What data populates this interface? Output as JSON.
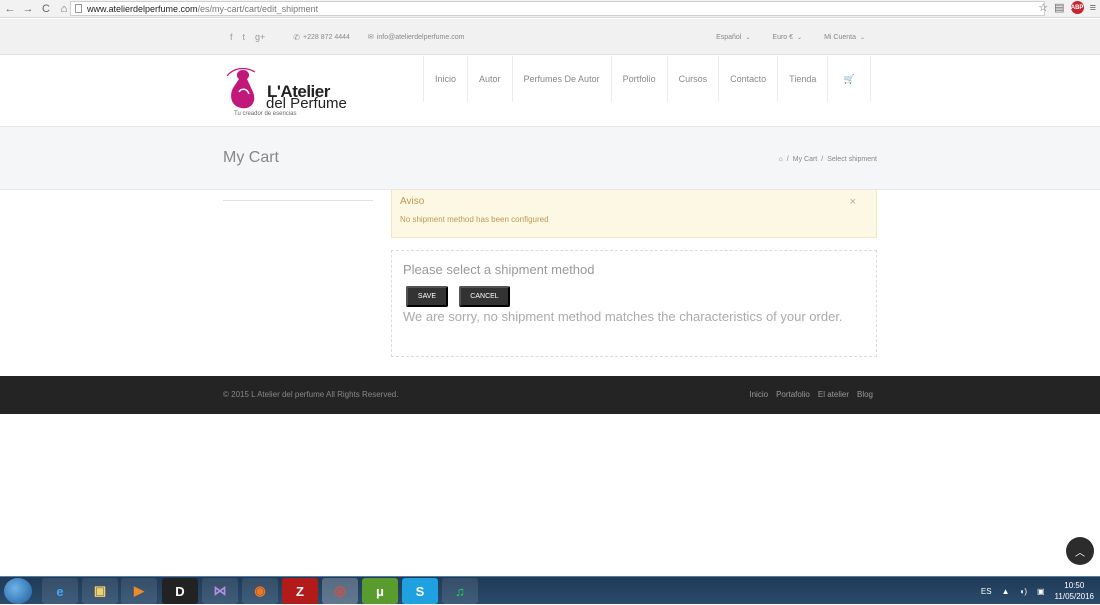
{
  "browser": {
    "nav_back": "←",
    "nav_forward": "→",
    "reload": "C",
    "home": "⌂",
    "url_host": "www.atelierdelperfume.com",
    "url_path": "/es/my-cart/cart/edit_shipment",
    "star": "☆",
    "menu": "≡",
    "adblock": "ABP"
  },
  "topbar": {
    "facebook": "f",
    "twitter": "t",
    "gplus": "g+",
    "phone_icon": "✆",
    "phone": "+228 872 4444",
    "email_icon": "✉",
    "email": "info@atelierdelperfume.com",
    "language": "Español",
    "currency": "Euro €",
    "account": "Mi Cuenta",
    "chevron": "⌄"
  },
  "logo": {
    "line1": "L'Atelier",
    "line2": "del Perfume",
    "tagline": "Tu creador de esencias"
  },
  "nav": {
    "items": [
      "Inicio",
      "Autor",
      "Perfumes De Autor",
      "Portfolio",
      "Cursos",
      "Contacto",
      "Tienda"
    ],
    "cart_icon": "🛒"
  },
  "page": {
    "title": "My Cart",
    "breadcrumb_home": "⌂",
    "breadcrumb_sep": "/",
    "breadcrumb_cart": "My Cart",
    "breadcrumb_current": "Select shipment"
  },
  "alert": {
    "title": "Aviso",
    "message": "No shipment method has been configured",
    "close": "×"
  },
  "shipment": {
    "title": "Please select a shipment method",
    "save": "SAVE",
    "cancel": "CANCEL",
    "message": "We are sorry, no shipment method matches the characteristics of your order."
  },
  "footer": {
    "copyright": "© 2015 L Atelier del perfume All Rights Reserved.",
    "links": [
      "Inicio",
      "Portafolio",
      "El atelier",
      "Blog"
    ]
  },
  "scroll_top": "︿",
  "taskbar": {
    "apps": [
      "e",
      "▣",
      "▶",
      "D",
      "⋈",
      "◉",
      "Z",
      "◎",
      "μ",
      "S",
      "♫"
    ],
    "lang": "ES",
    "time": "10:50",
    "date": "11/05/2016"
  }
}
